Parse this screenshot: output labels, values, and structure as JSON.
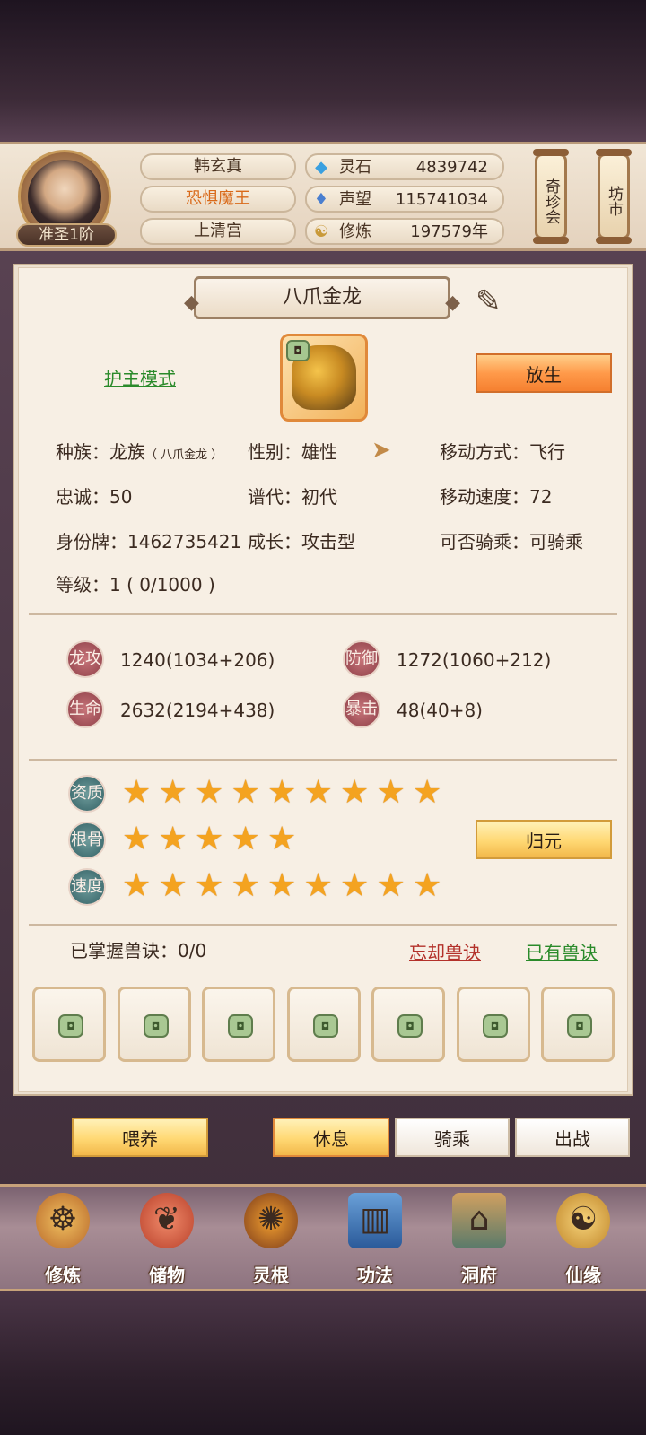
{
  "player": {
    "rank": "准圣1阶",
    "name": "韩玄真",
    "title": "恐惧魔王",
    "sect": "上清宫"
  },
  "resources": [
    {
      "label": "灵石",
      "value": "4839742",
      "icon": "gem-icon",
      "color": "#3aa0e0"
    },
    {
      "label": "声望",
      "value": "115741034",
      "icon": "flame-icon",
      "color": "#4a7fd0"
    },
    {
      "label": "修炼",
      "value": "197579年",
      "icon": "meditation-icon",
      "color": "#c99a3a"
    }
  ],
  "side_buttons": {
    "treasure": "奇珍会",
    "market": "坊市"
  },
  "pet": {
    "name": "八爪金龙",
    "mode_link": "护主模式",
    "release_button": "放生",
    "info": {
      "race": "种族：龙族",
      "race_sub": "（ 八爪金龙 ）",
      "gender": "性别：雄性",
      "move_type": "移动方式：飞行",
      "loyalty": "忠诚：50",
      "generation": "谱代：初代",
      "move_speed": "移动速度：72",
      "id_tag": "身份牌：1462735421",
      "growth": "成长：攻击型",
      "rideable": "可否骑乘：可骑乘",
      "level": "等级：1 ( 0/1000 )"
    },
    "stats": [
      {
        "badge": "龙攻",
        "value": "1240(1034+206)"
      },
      {
        "badge": "防御",
        "value": "1272(1060+212)"
      },
      {
        "badge": "生命",
        "value": "2632(2194+438)"
      },
      {
        "badge": "暴击",
        "value": "48(40+8)"
      }
    ],
    "ratings": [
      {
        "badge": "资质",
        "stars": 9
      },
      {
        "badge": "根骨",
        "stars": 5
      },
      {
        "badge": "速度",
        "stars": 9
      }
    ],
    "reset_button": "归元",
    "skills_mastered": "已掌握兽诀：0/0",
    "forget_link": "忘却兽诀",
    "owned_link": "已有兽诀",
    "skill_slots": 7
  },
  "actions": {
    "feed": "喂养",
    "rest": "休息",
    "ride": "骑乘",
    "battle": "出战"
  },
  "nav": [
    {
      "label": "修炼",
      "icon": "cultivate-icon"
    },
    {
      "label": "储物",
      "icon": "bag-icon"
    },
    {
      "label": "灵根",
      "icon": "spirit-root-icon"
    },
    {
      "label": "功法",
      "icon": "book-icon"
    },
    {
      "label": "洞府",
      "icon": "cave-icon"
    },
    {
      "label": "仙缘",
      "icon": "gourd-icon"
    }
  ]
}
